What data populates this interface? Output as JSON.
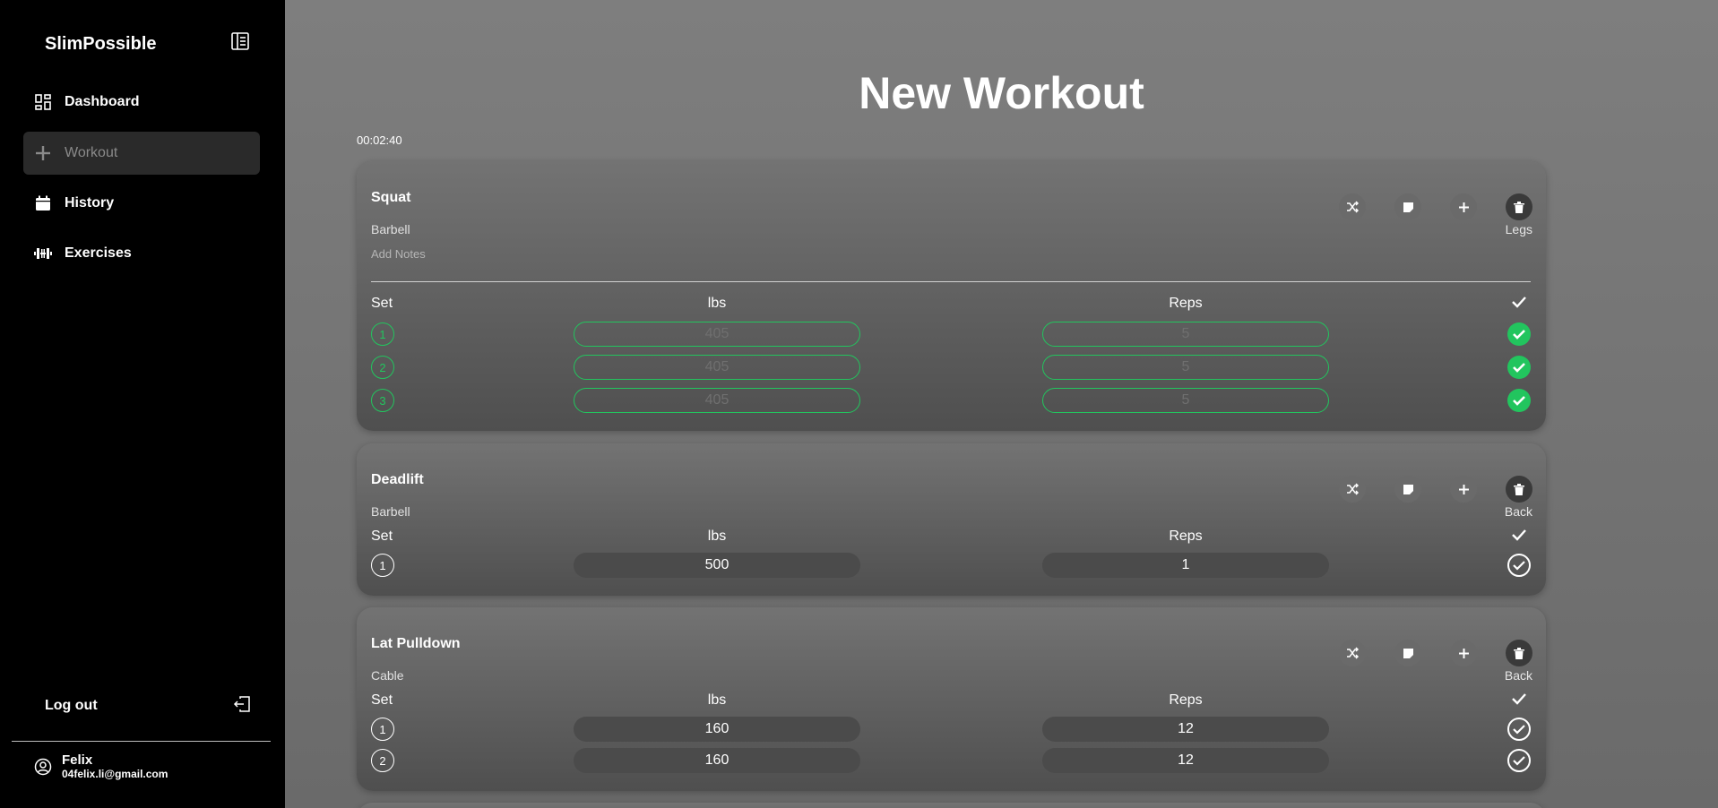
{
  "sidebar": {
    "brand": "SlimPossible",
    "items": [
      {
        "label": "Dashboard",
        "icon": "dashboard-icon"
      },
      {
        "label": "Workout",
        "icon": "plus-icon",
        "active": true
      },
      {
        "label": "History",
        "icon": "calendar-icon"
      },
      {
        "label": "Exercises",
        "icon": "dumbbell-icon"
      }
    ],
    "logout": "Log out",
    "user": {
      "name": "Felix",
      "email": "04felix.li@gmail.com"
    }
  },
  "main": {
    "title": "New Workout",
    "timer": "00:02:40",
    "headers": {
      "set": "Set",
      "lbs": "lbs",
      "reps": "Reps"
    },
    "exercises": [
      {
        "name": "Squat",
        "equipment": "Barbell",
        "muscle": "Legs",
        "notes_placeholder": "Add Notes",
        "sets": [
          {
            "num": "1",
            "lbs": "405",
            "reps": "5",
            "done": true
          },
          {
            "num": "2",
            "lbs": "405",
            "reps": "5",
            "done": true
          },
          {
            "num": "3",
            "lbs": "405",
            "reps": "5",
            "done": true
          }
        ]
      },
      {
        "name": "Deadlift",
        "equipment": "Barbell",
        "muscle": "Back",
        "sets": [
          {
            "num": "1",
            "lbs": "500",
            "reps": "1",
            "done": false
          }
        ]
      },
      {
        "name": "Lat Pulldown",
        "equipment": "Cable",
        "muscle": "Back",
        "sets": [
          {
            "num": "1",
            "lbs": "160",
            "reps": "12",
            "done": false
          },
          {
            "num": "2",
            "lbs": "160",
            "reps": "12",
            "done": false
          }
        ]
      }
    ]
  },
  "colors": {
    "accent_green": "#22c55e",
    "sidebar_bg": "#000000"
  }
}
